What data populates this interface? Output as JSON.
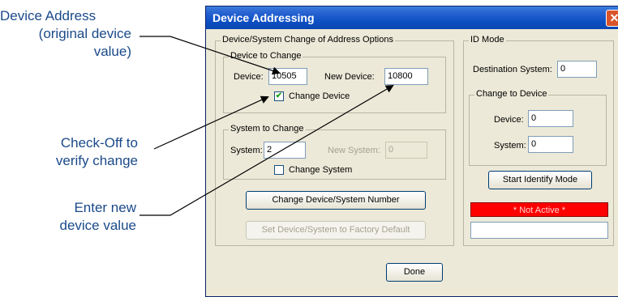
{
  "annotations": {
    "device_address": [
      "Device Address",
      "(original device",
      "value)"
    ],
    "checkoff": [
      "Check-Off to",
      "verify change"
    ],
    "enter_new": [
      "Enter new",
      "device value"
    ]
  },
  "window": {
    "title": "Device Addressing",
    "close_glyph": "✕"
  },
  "options_group": {
    "label": "Device/System Change of Address Options",
    "device_group": {
      "label": "Device to Change",
      "device_label": "Device:",
      "device_value": "10505",
      "new_device_label": "New Device:",
      "new_device_value": "10800",
      "checkbox_label": "Change Device",
      "checkbox_checked": true,
      "check_glyph": "✔"
    },
    "system_group": {
      "label": "System to Change",
      "system_label": "System:",
      "system_value": "2",
      "new_system_label": "New System:",
      "new_system_value": "0",
      "checkbox_label": "Change System",
      "checkbox_checked": false
    },
    "change_button": "Change Device/System Number",
    "factory_button": "Set Device/System to Factory Default"
  },
  "id_mode": {
    "label": "ID Mode",
    "destination_label": "Destination System:",
    "destination_value": "0",
    "change_group": {
      "label": "Change to Device",
      "device_label": "Device:",
      "device_value": "0",
      "system_label": "System:",
      "system_value": "0"
    },
    "start_button": "Start Identify Mode",
    "status_text": "* Not Active *",
    "status_color": "#ff0000"
  },
  "done_button": "Done",
  "colors": {
    "annotation_text": "#1a4a8a",
    "titlebar": "#0b4ec2",
    "dialog_bg": "#ece9d8"
  }
}
